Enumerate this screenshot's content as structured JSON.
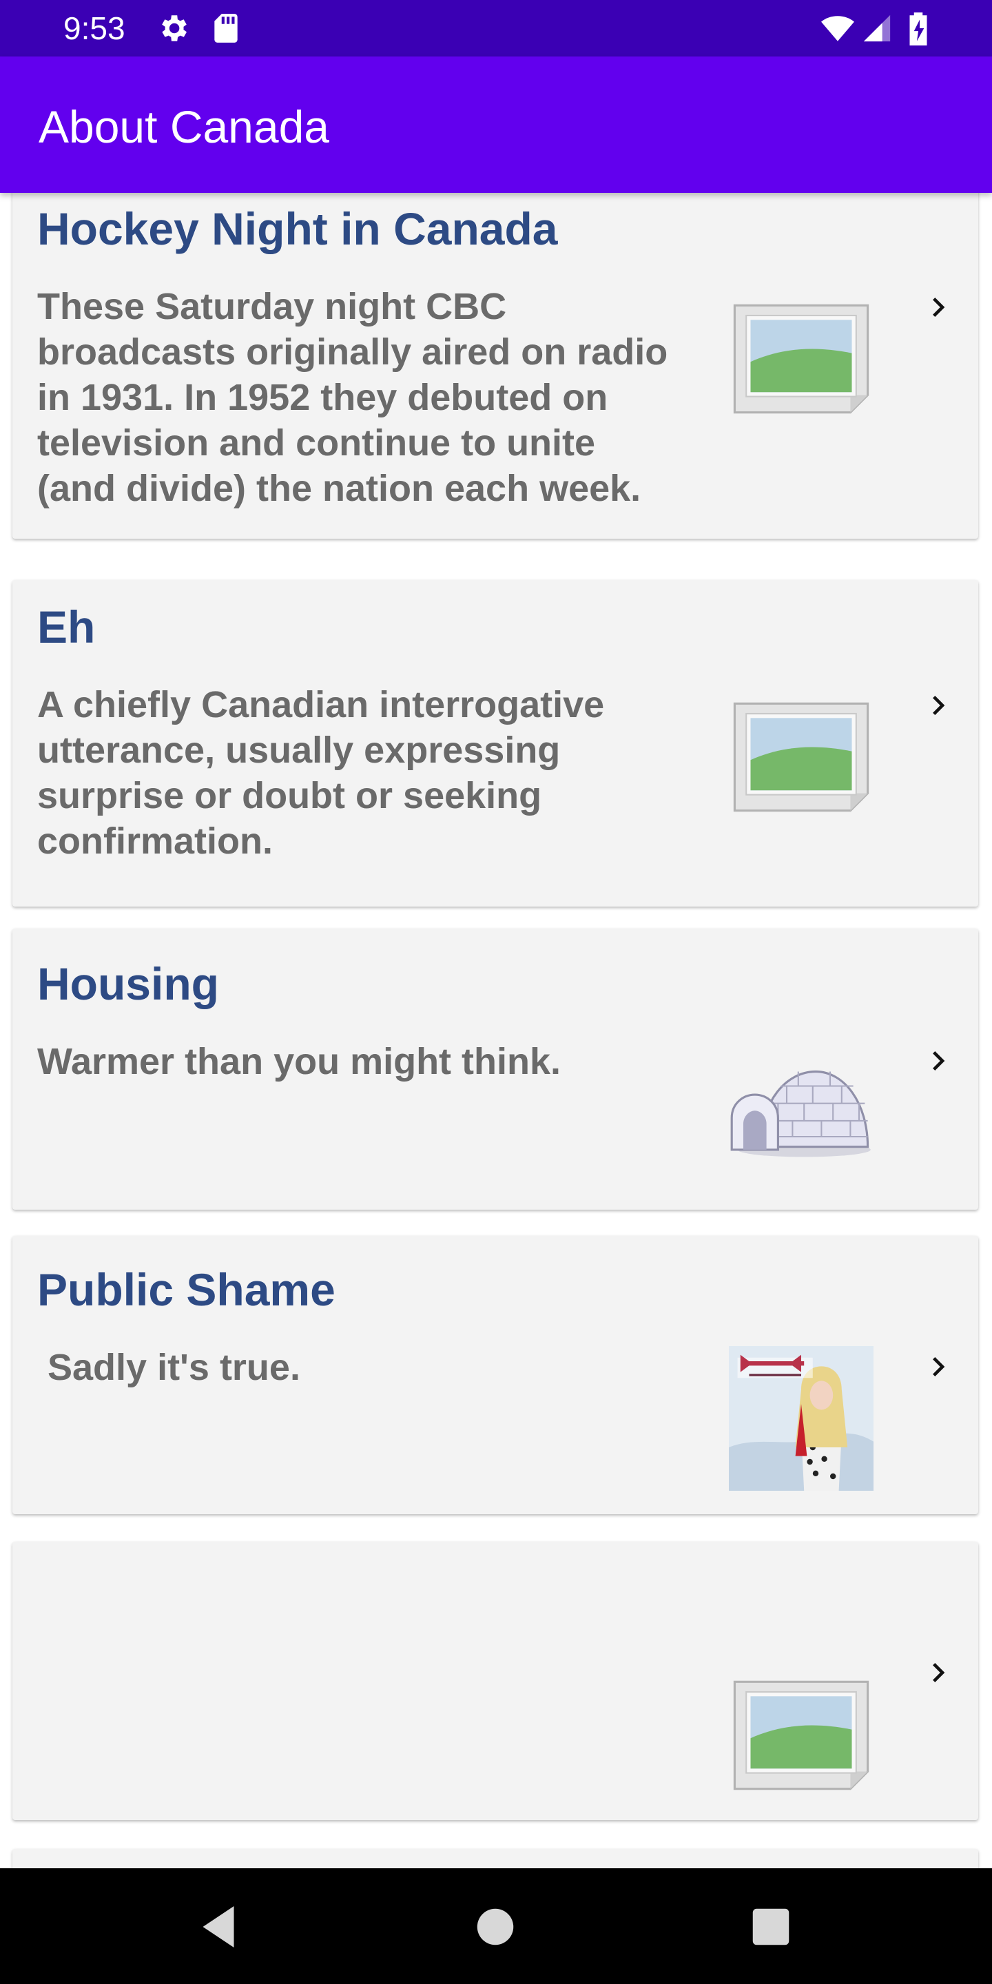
{
  "status_bar": {
    "time": "9:53",
    "icons": [
      "gear-icon",
      "sd-card-icon",
      "wifi-icon",
      "signal-icon",
      "battery-charging-icon"
    ]
  },
  "app_bar": {
    "title": "About Canada"
  },
  "cards": [
    {
      "title": "Hockey Night in Canada",
      "description": "These Saturday night CBC broadcasts originally aired on radio in 1931. In 1952 they debuted on television and continue to unite (and divide) the nation each week.",
      "image": "image-placeholder-icon"
    },
    {
      "title": "Eh",
      "description": "A chiefly Canadian interrogative utterance, usually expressing surprise or doubt or seeking confirmation.",
      "image": "image-placeholder-icon"
    },
    {
      "title": "Housing",
      "description": "Warmer than you might think.",
      "image": "igloo-icon"
    },
    {
      "title": "Public Shame",
      "description": " Sadly it's true.",
      "image": "album-cover-image"
    },
    {
      "title": "",
      "description": "",
      "image": "image-placeholder-icon"
    }
  ],
  "nav_bar": {
    "buttons": [
      "back-icon",
      "home-icon",
      "overview-icon"
    ]
  },
  "colors": {
    "status_bar": "#3b00b4",
    "app_bar": "#6200ee",
    "card_background": "#f3f3f3",
    "title": "#2d4a84",
    "description": "#6a6a6a"
  }
}
